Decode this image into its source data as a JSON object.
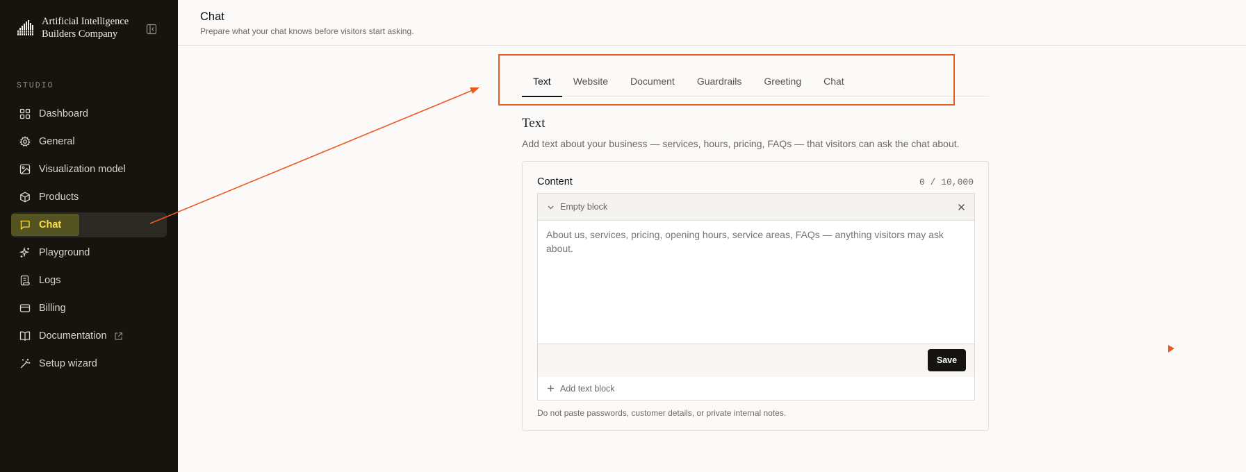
{
  "brand": {
    "line1": "Artificial Intelligence",
    "line2": "Builders Company"
  },
  "sidebar": {
    "section_label": "STUDIO",
    "items": [
      {
        "label": "Dashboard",
        "icon": "grid-icon"
      },
      {
        "label": "General",
        "icon": "gear-icon"
      },
      {
        "label": "Visualization model",
        "icon": "image-icon"
      },
      {
        "label": "Products",
        "icon": "box-icon"
      },
      {
        "label": "Chat",
        "icon": "chat-icon",
        "active": true
      },
      {
        "label": "Playground",
        "icon": "sparkles-icon"
      },
      {
        "label": "Logs",
        "icon": "scroll-icon"
      },
      {
        "label": "Billing",
        "icon": "card-icon"
      },
      {
        "label": "Documentation",
        "icon": "book-icon",
        "external": true
      },
      {
        "label": "Setup wizard",
        "icon": "wand-icon"
      }
    ]
  },
  "header": {
    "title": "Chat",
    "subtitle": "Prepare what your chat knows before visitors start asking."
  },
  "tabs": [
    {
      "label": "Text",
      "active": true
    },
    {
      "label": "Website"
    },
    {
      "label": "Document"
    },
    {
      "label": "Guardrails"
    },
    {
      "label": "Greeting"
    },
    {
      "label": "Chat"
    }
  ],
  "section": {
    "title": "Text",
    "description": "Add text about your business — services, hours, pricing, FAQs — that visitors can ask the chat about."
  },
  "editor": {
    "content_label": "Content",
    "char_count": "0 / 10,000",
    "block_label": "Empty block",
    "placeholder": "About us, services, pricing, opening hours, service areas, FAQs — anything visitors may ask about.",
    "save_label": "Save",
    "add_block_label": "Add text block",
    "note": "Do not paste passwords, customer details, or private internal notes."
  },
  "colors": {
    "sidebar_bg": "#16140f",
    "active_label": "#fde047",
    "annotation": "#ea5a1f"
  }
}
